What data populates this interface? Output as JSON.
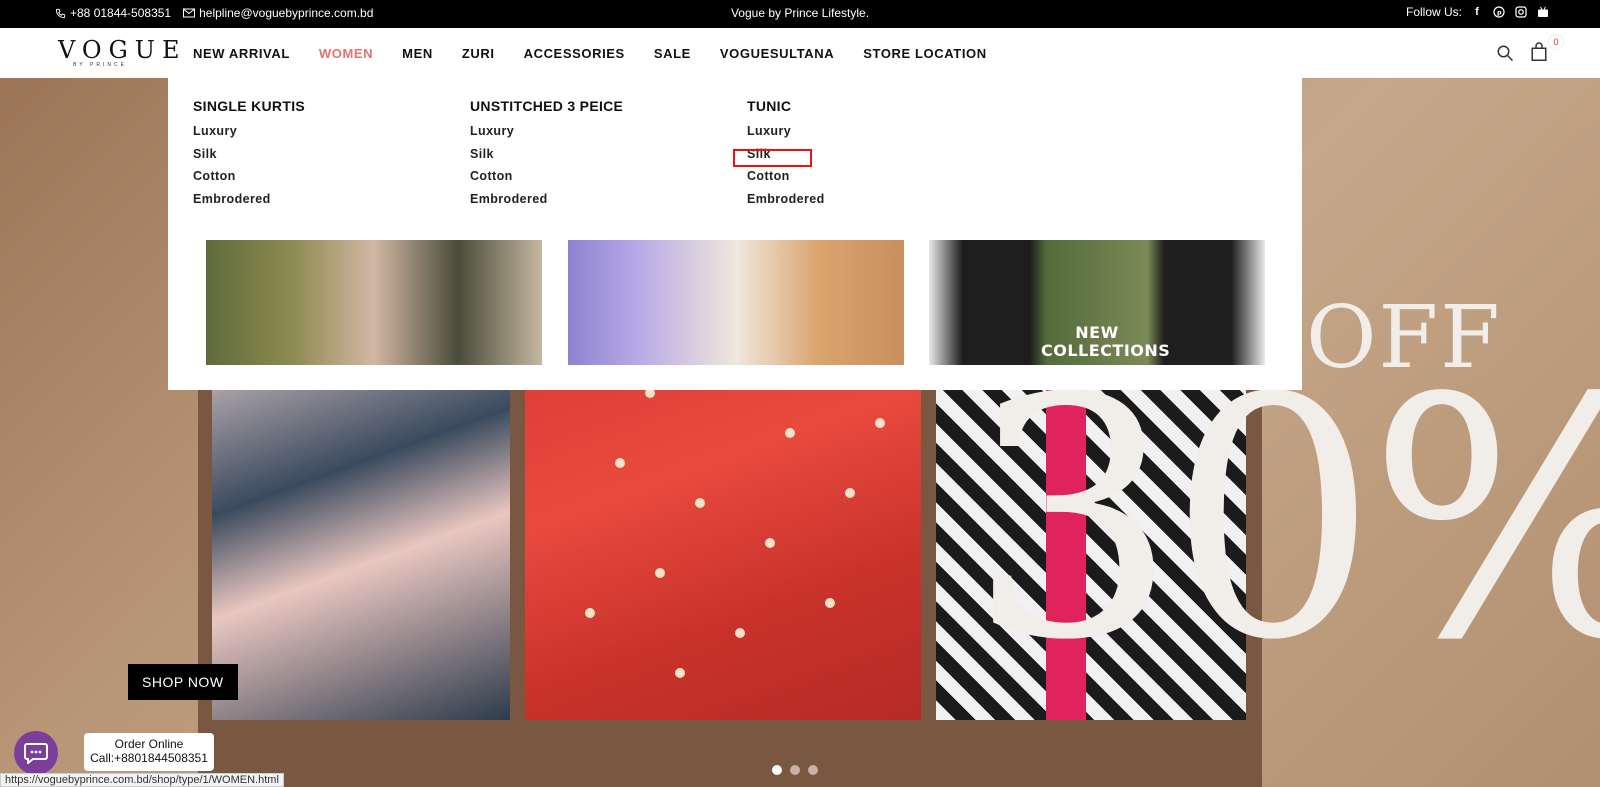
{
  "topbar": {
    "phone": "+88 01844-508351",
    "email": "helpline@voguebyprince.com.bd",
    "tagline": "Vogue by Prince Lifestyle.",
    "follow_label": "Follow Us:",
    "social": [
      "facebook-icon",
      "pinterest-icon",
      "instagram-icon",
      "youtube-icon"
    ]
  },
  "header": {
    "logo_main": "VOGUE",
    "logo_sub": "BY PRINCE",
    "nav": [
      "NEW ARRIVAL",
      "WOMEN",
      "MEN",
      "ZURI",
      "ACCESSORIES",
      "SALE",
      "VOGUESULTANA",
      "STORE LOCATION"
    ],
    "active_nav": "WOMEN",
    "cart_count": "0"
  },
  "mega_menu": {
    "columns": [
      {
        "title": "SINGLE KURTIS",
        "items": [
          "Luxury",
          "Silk",
          "Cotton",
          "Embrodered"
        ]
      },
      {
        "title": "UNSTITCHED 3 PEICE",
        "items": [
          "Luxury",
          "Silk",
          "Cotton",
          "Embrodered"
        ]
      },
      {
        "title": "TUNIC",
        "items": [
          "Luxury",
          "Silk",
          "Cotton",
          "Embrodered"
        ]
      }
    ],
    "promo_new_collections_line1": "NEW",
    "promo_new_collections_line2": "COLLECTIONS"
  },
  "hero": {
    "offer_off": "OFF",
    "offer_pct": "30%",
    "cta": "SHOP NOW",
    "slides": 3,
    "active_slide": 1
  },
  "chat": {
    "line1": "Order Online",
    "line2": "Call:+8801844508351"
  },
  "statusbar": {
    "url": "https://voguebyprince.com.bd/shop/type/1/WOMEN.html"
  },
  "colors": {
    "accent": "#e27274",
    "topbar_bg": "#000000",
    "chat_bg": "#7b3f9b",
    "highlight": "#ee1111"
  }
}
